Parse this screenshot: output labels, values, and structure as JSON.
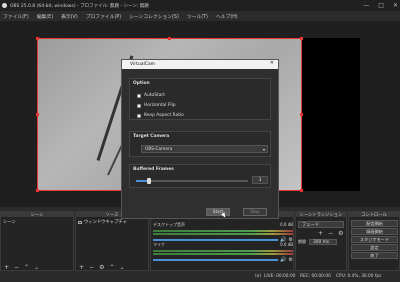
{
  "window": {
    "title": "OBS 25.0.8 (64-bit, windows) - プロファイル: 無題 - シーン: 無題",
    "minimize": "—",
    "maximize": "□",
    "close": "✕"
  },
  "menu": [
    "ファイル(F)",
    "編集(E)",
    "表示(V)",
    "プロファイル(P)",
    "シーンコレクション(S)",
    "ツール(T)",
    "ヘルプ(H)"
  ],
  "dialog": {
    "title": "VirtualCam",
    "option_header": "Option",
    "options": [
      "AutoStart",
      "Horizontal Flip",
      "Keep Aspect Ratio"
    ],
    "target_header": "Target Camera",
    "target_value": "OBS-Camera",
    "buffer_header": "Buffered Frames",
    "buffer_value": "3",
    "buffer_level": 0.12,
    "start_label": "Start",
    "stop_label": "Stop"
  },
  "docks": {
    "scenes": {
      "title": "シーン",
      "items": [
        "シーン"
      ]
    },
    "sources": {
      "title": "ソース",
      "items": [
        "ウィンドウキャプチャ"
      ]
    },
    "mixer": {
      "channels": [
        {
          "name": "デスクトップ音声",
          "db": "0.0 dB"
        },
        {
          "name": "マイク",
          "db": "0.0 dB"
        }
      ]
    },
    "transitions": {
      "title": "シーントランジション",
      "type": "フェード",
      "duration_label": "期間",
      "duration_value": "300 ms"
    },
    "controls": {
      "title": "コントロール",
      "buttons": [
        "配信開始",
        "録画開始",
        "スタジオモード",
        "設定",
        "終了"
      ]
    }
  },
  "status": {
    "live": "LIVE: 00:00:00",
    "rec": "REC: 00:00:00",
    "cpu": "CPU: 0.4%, 30.00 fps",
    "dropped": "(e)"
  },
  "colors": {
    "selection": "#e33333",
    "accent": "#4a90d9",
    "meter_green": "#4d9d4d"
  }
}
